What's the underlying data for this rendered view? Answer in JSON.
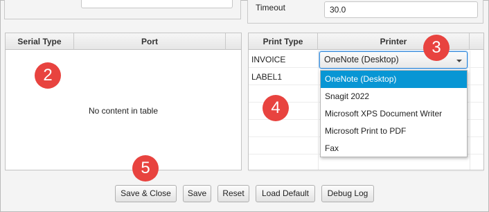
{
  "settings": {
    "timeout_label": "Timeout",
    "timeout_value": "30.0"
  },
  "serial_table": {
    "columns": [
      "Serial Type",
      "Port"
    ],
    "empty_message": "No content in table"
  },
  "print_table": {
    "columns": [
      "Print Type",
      "Printer"
    ],
    "rows": [
      {
        "print_type": "INVOICE",
        "printer": "OneNote (Desktop)"
      },
      {
        "print_type": "LABEL1",
        "printer": ""
      }
    ]
  },
  "printer_dropdown": {
    "selected": "OneNote (Desktop)",
    "options": [
      "OneNote (Desktop)",
      "Snagit 2022",
      "Microsoft XPS Document Writer",
      "Microsoft Print to PDF",
      "Fax"
    ]
  },
  "callouts": [
    "2",
    "3",
    "4",
    "5"
  ],
  "buttons": {
    "save_close": "Save & Close",
    "save": "Save",
    "reset": "Reset",
    "load_default": "Load Default",
    "debug_log": "Debug Log"
  },
  "colors": {
    "callout": "#e8433f",
    "selection": "#0896d4",
    "focus_border": "#3b8edb"
  }
}
